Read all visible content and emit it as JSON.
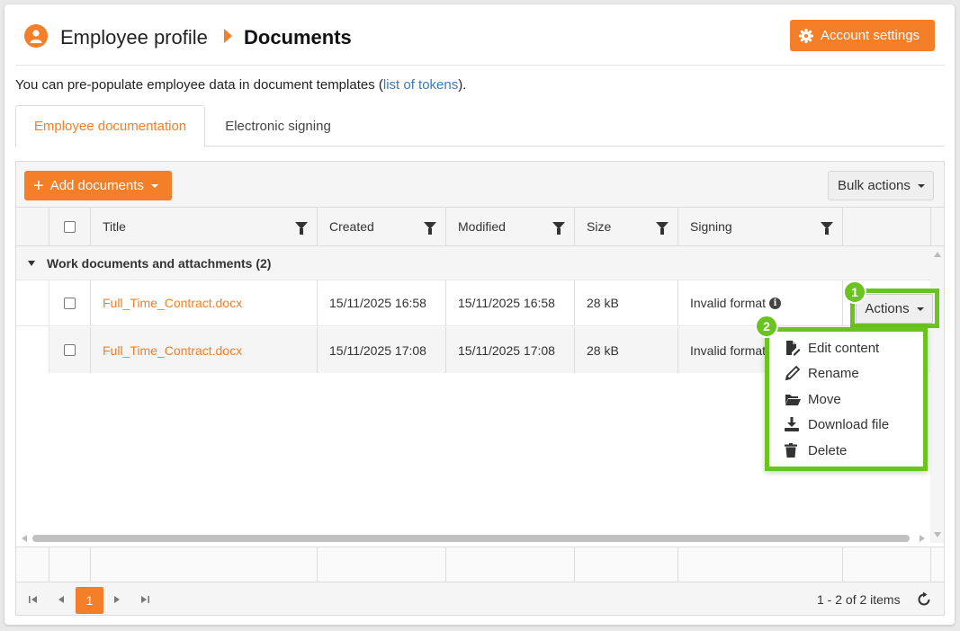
{
  "header": {
    "crumb_parent": "Employee profile",
    "crumb_current": "Documents",
    "account_settings_label": "Account settings"
  },
  "info": {
    "prefix": "You can pre-populate employee data in document templates (",
    "link_text": "list of tokens",
    "suffix": ")."
  },
  "tabs": [
    {
      "label": "Employee documentation",
      "active": true
    },
    {
      "label": "Electronic signing",
      "active": false
    }
  ],
  "toolbar": {
    "add_label": "Add documents",
    "bulk_label": "Bulk actions"
  },
  "columns": [
    "Title",
    "Created",
    "Modified",
    "Size",
    "Signing"
  ],
  "group": {
    "label": "Work documents and attachments (2)"
  },
  "rows": [
    {
      "title": "Full_Time_Contract.docx",
      "created": "15/11/2025 16:58",
      "modified": "15/11/2025 16:58",
      "size": "28 kB",
      "signing": "Invalid format"
    },
    {
      "title": "Full_Time_Contract.docx",
      "created": "15/11/2025 17:08",
      "modified": "15/11/2025 17:08",
      "size": "28 kB",
      "signing": "Invalid format"
    }
  ],
  "actions_label": "Actions",
  "menu": [
    "Edit content",
    "Rename",
    "Move",
    "Download file",
    "Delete"
  ],
  "pager": {
    "current_page": "1",
    "info": "1 - 2 of 2 items"
  },
  "badges": [
    "1",
    "2"
  ],
  "colors": {
    "accent": "#f57f29",
    "highlight": "#6ac31f",
    "link": "#3a7bbf"
  }
}
